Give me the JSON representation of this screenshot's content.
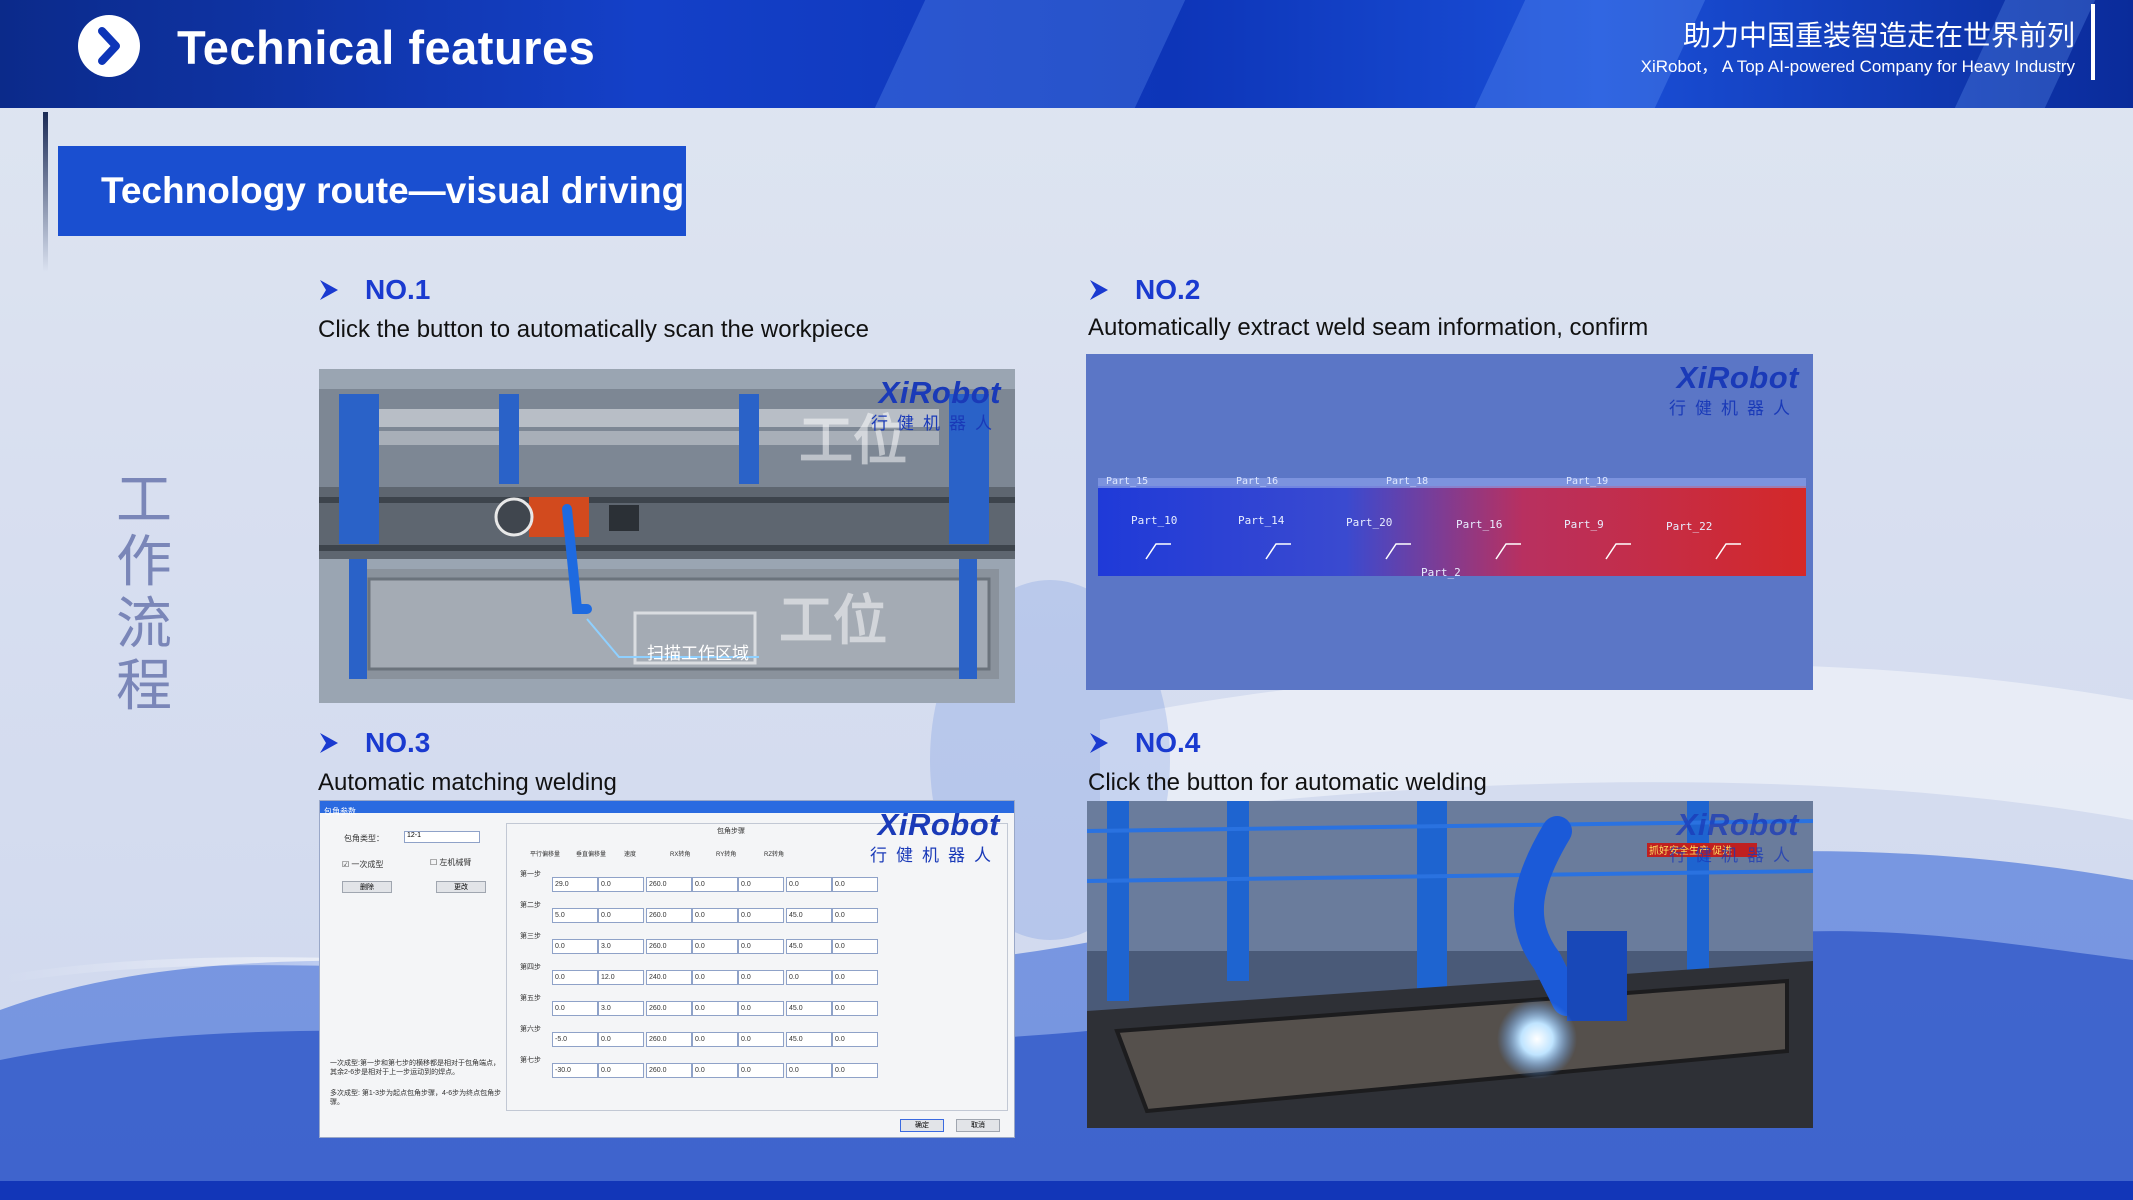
{
  "header": {
    "title": "Technical features",
    "cn_slogan": "助力中国重装智造走在世界前列",
    "en_slogan": "XiRobot， A Top AI-powered Company for Heavy Industry"
  },
  "route_title": "Technology route—visual driving",
  "side_label": "工作流程",
  "watermark": {
    "brand": "XiRobot",
    "cn": "行健机器人"
  },
  "steps": [
    {
      "no": "NO.1",
      "desc": "Click the button to automatically scan the workpiece",
      "overlay_label": "扫描工作区域",
      "station_label": "工位"
    },
    {
      "no": "NO.2",
      "desc": "Automatically extract weld seam information, confirm"
    },
    {
      "no": "NO.3",
      "desc": "Automatic matching welding"
    },
    {
      "no": "NO.4",
      "desc": "Click the button for automatic welding",
      "banner": "抓好安全生产 促进"
    }
  ],
  "weld_labels": [
    "Part_10",
    "Part_14",
    "Part_20",
    "Part_16",
    "Part_9",
    "Part_22",
    "Part_2",
    "Part_15",
    "Part_16",
    "Part_18",
    "Part_19"
  ],
  "dialog": {
    "title": "包角参数",
    "type_label": "包角类型：",
    "type_value": "12-1",
    "check1": "一次成型",
    "check2": "左机械臂",
    "btn_delete": "删除",
    "btn_modify": "更改",
    "group_label": "包角步骤",
    "columns": [
      "平行偏移量",
      "垂直偏移量",
      "速度",
      "RX转角",
      "RY转角",
      "RZ转角",
      "",
      ""
    ],
    "rows": [
      {
        "label": "第一步",
        "values": [
          "29.0",
          "0.0",
          "260.0",
          "0.0",
          "0.0",
          "0.0",
          "0.0"
        ]
      },
      {
        "label": "第二步",
        "values": [
          "5.0",
          "0.0",
          "260.0",
          "0.0",
          "0.0",
          "45.0",
          "0.0"
        ]
      },
      {
        "label": "第三步",
        "values": [
          "0.0",
          "3.0",
          "260.0",
          "0.0",
          "0.0",
          "45.0",
          "0.0"
        ]
      },
      {
        "label": "第四步",
        "values": [
          "0.0",
          "12.0",
          "240.0",
          "0.0",
          "0.0",
          "0.0",
          "0.0"
        ]
      },
      {
        "label": "第五步",
        "values": [
          "0.0",
          "3.0",
          "260.0",
          "0.0",
          "0.0",
          "45.0",
          "0.0"
        ]
      },
      {
        "label": "第六步",
        "values": [
          "-5.0",
          "0.0",
          "260.0",
          "0.0",
          "0.0",
          "45.0",
          "0.0"
        ]
      },
      {
        "label": "第七步",
        "values": [
          "-30.0",
          "0.0",
          "260.0",
          "0.0",
          "0.0",
          "0.0",
          "0.0"
        ]
      }
    ],
    "note1": "一次成型:第一步和第七步的横移都是相对于包角端点，其余2-6步是相对于上一步运动到的焊点。",
    "note2": "多次成型: 第1-3步为起点包角步骤，4-6步为终点包角步骤。",
    "ok": "确定",
    "cancel": "取消"
  },
  "colors": {
    "accent": "#1a4fd0",
    "header": "#0d35b8",
    "heading": "#1a3ad0"
  }
}
